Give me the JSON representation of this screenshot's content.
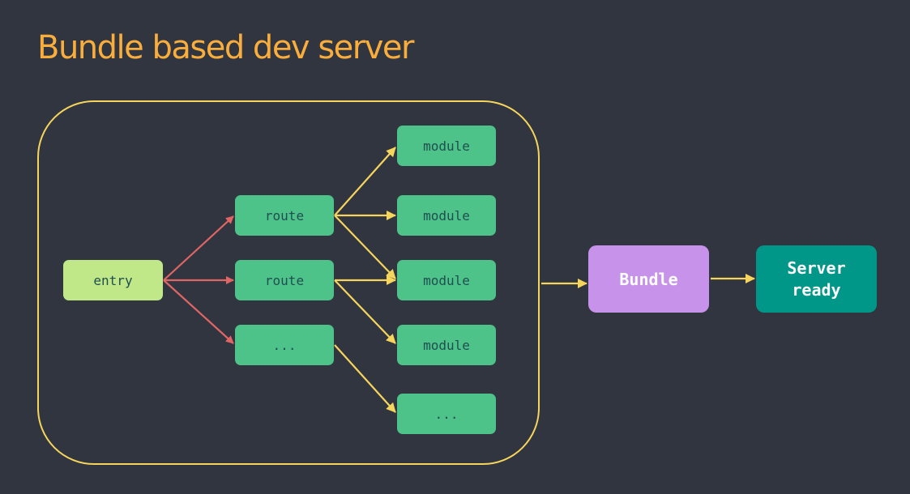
{
  "title": "Bundle based dev server",
  "colors": {
    "background": "#31353f",
    "title": "#f9ad3c",
    "container": "#f6d55c",
    "entry_edge": "#e06666",
    "module_edge": "#f6d55c"
  },
  "nodes": {
    "entry": "entry",
    "routes": [
      "route",
      "route",
      "..."
    ],
    "modules": [
      "module",
      "module",
      "module",
      "module",
      "..."
    ],
    "bundle": "Bundle",
    "server": "Server\nready",
    "server_lines": [
      "Server",
      "ready"
    ]
  },
  "edges": [
    {
      "from": "entry",
      "to": "route-1"
    },
    {
      "from": "entry",
      "to": "route-2"
    },
    {
      "from": "entry",
      "to": "route-3"
    },
    {
      "from": "route-1",
      "to": "module-1"
    },
    {
      "from": "route-1",
      "to": "module-2"
    },
    {
      "from": "route-1",
      "to": "module-3"
    },
    {
      "from": "route-2",
      "to": "module-3"
    },
    {
      "from": "route-2",
      "to": "module-4"
    },
    {
      "from": "route-3",
      "to": "module-5"
    },
    {
      "from": "container",
      "to": "bundle"
    },
    {
      "from": "bundle",
      "to": "server"
    }
  ]
}
